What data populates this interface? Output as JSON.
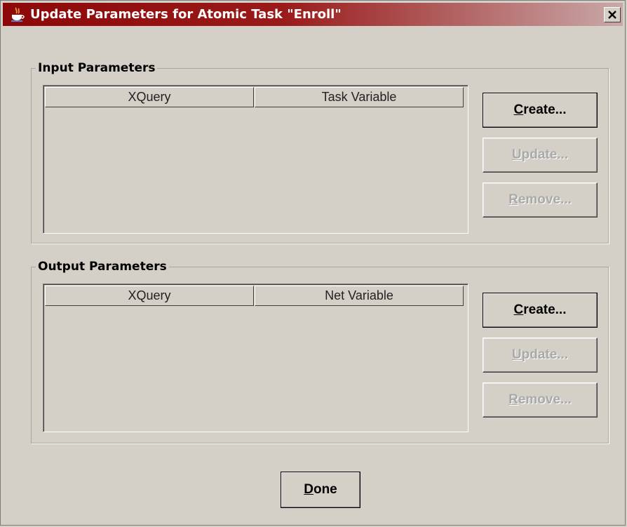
{
  "window": {
    "title": "Update Parameters for Atomic Task \"Enroll\""
  },
  "icons": {
    "app": "java-coffee-cup-icon",
    "close": "close-icon"
  },
  "colors": {
    "title_gradient_start": "#8d0808",
    "title_gradient_end": "#c9a8a8",
    "panel_background": "#d4d0c8",
    "disabled_text": "#a9a9a9"
  },
  "input_parameters": {
    "legend": "Input Parameters",
    "columns": [
      "XQuery",
      "Task Variable"
    ],
    "rows": [],
    "buttons": {
      "create": {
        "mnemonic": "C",
        "rest": "reate..."
      },
      "update": {
        "mnemonic": "U",
        "rest": "pdate...",
        "enabled": false
      },
      "remove": {
        "mnemonic": "R",
        "rest": "emove...",
        "enabled": false
      }
    }
  },
  "output_parameters": {
    "legend": "Output Parameters",
    "columns": [
      "XQuery",
      "Net Variable"
    ],
    "rows": [],
    "buttons": {
      "create": {
        "mnemonic": "C",
        "rest": "reate..."
      },
      "update": {
        "mnemonic": "U",
        "rest": "pdate...",
        "enabled": false
      },
      "remove": {
        "mnemonic": "R",
        "rest": "emove...",
        "enabled": false
      }
    }
  },
  "footer": {
    "done": {
      "mnemonic": "D",
      "rest": "one"
    }
  }
}
